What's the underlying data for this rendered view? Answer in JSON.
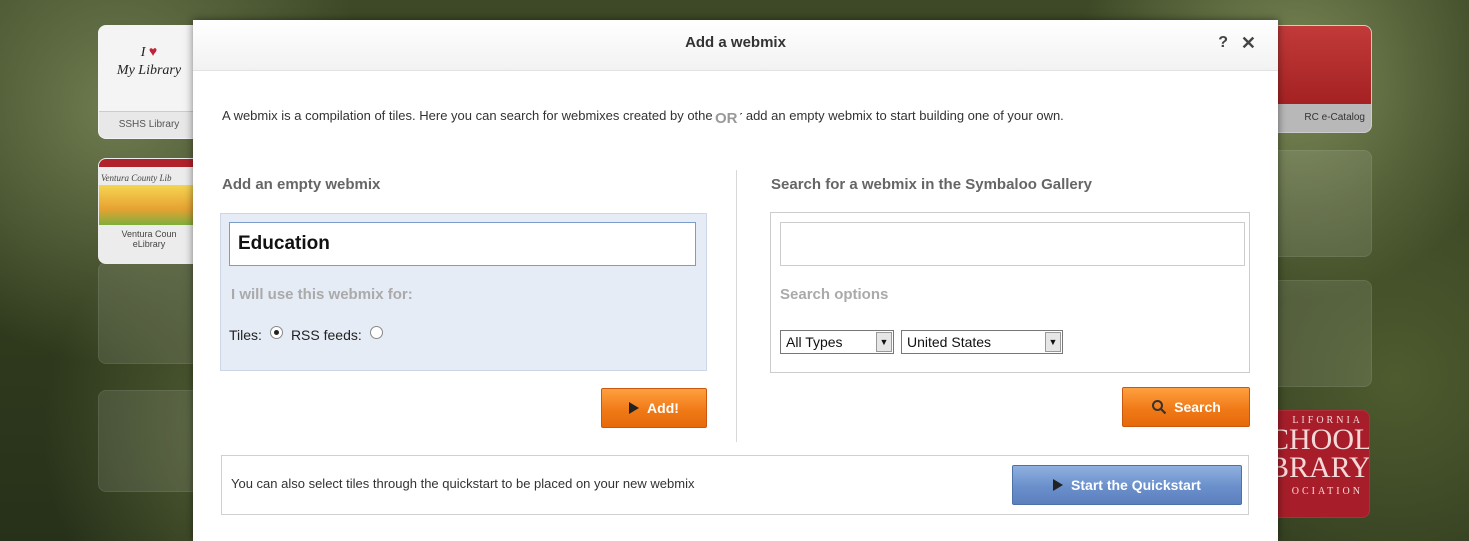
{
  "background_tiles": {
    "library": {
      "line1": "I",
      "line2": "My Library",
      "caption": "SSHS Library"
    },
    "ventura": {
      "title": "Ventura County Lib",
      "caption_line1": "Ventura Coun",
      "caption_line2": "eLibrary"
    },
    "scholastic": {
      "caption": "RC e-Catalog"
    },
    "california": {
      "line1": "LIFORNIA",
      "line2": "CHOOL",
      "line3": "BRARY",
      "line4": "OCIATION"
    }
  },
  "modal": {
    "title": "Add a webmix",
    "help": "?",
    "close": "✕",
    "intro": "A webmix is a compilation of tiles. Here you can search for webmixes created by others, or add an empty webmix to start building one of your own.",
    "or_label": "OR"
  },
  "left": {
    "title": "Add an empty webmix",
    "name_value": "Education",
    "use_label": "I will use this webmix for:",
    "tiles_label": "Tiles:",
    "rss_label": "RSS feeds:",
    "add_label": "Add!"
  },
  "right": {
    "title": "Search for a webmix in the Symbaloo Gallery",
    "search_value": "",
    "options_label": "Search options",
    "type_selected": "All Types",
    "country_selected": "United States",
    "search_label": "Search"
  },
  "bottom": {
    "text": "You can also select tiles through the quickstart to be placed on your new webmix",
    "quickstart_label": "Start the Quickstart"
  },
  "colors": {
    "orange_button": "#f07a17",
    "blue_button": "#6a8fcb",
    "left_box_bg": "#e6ecf6"
  }
}
